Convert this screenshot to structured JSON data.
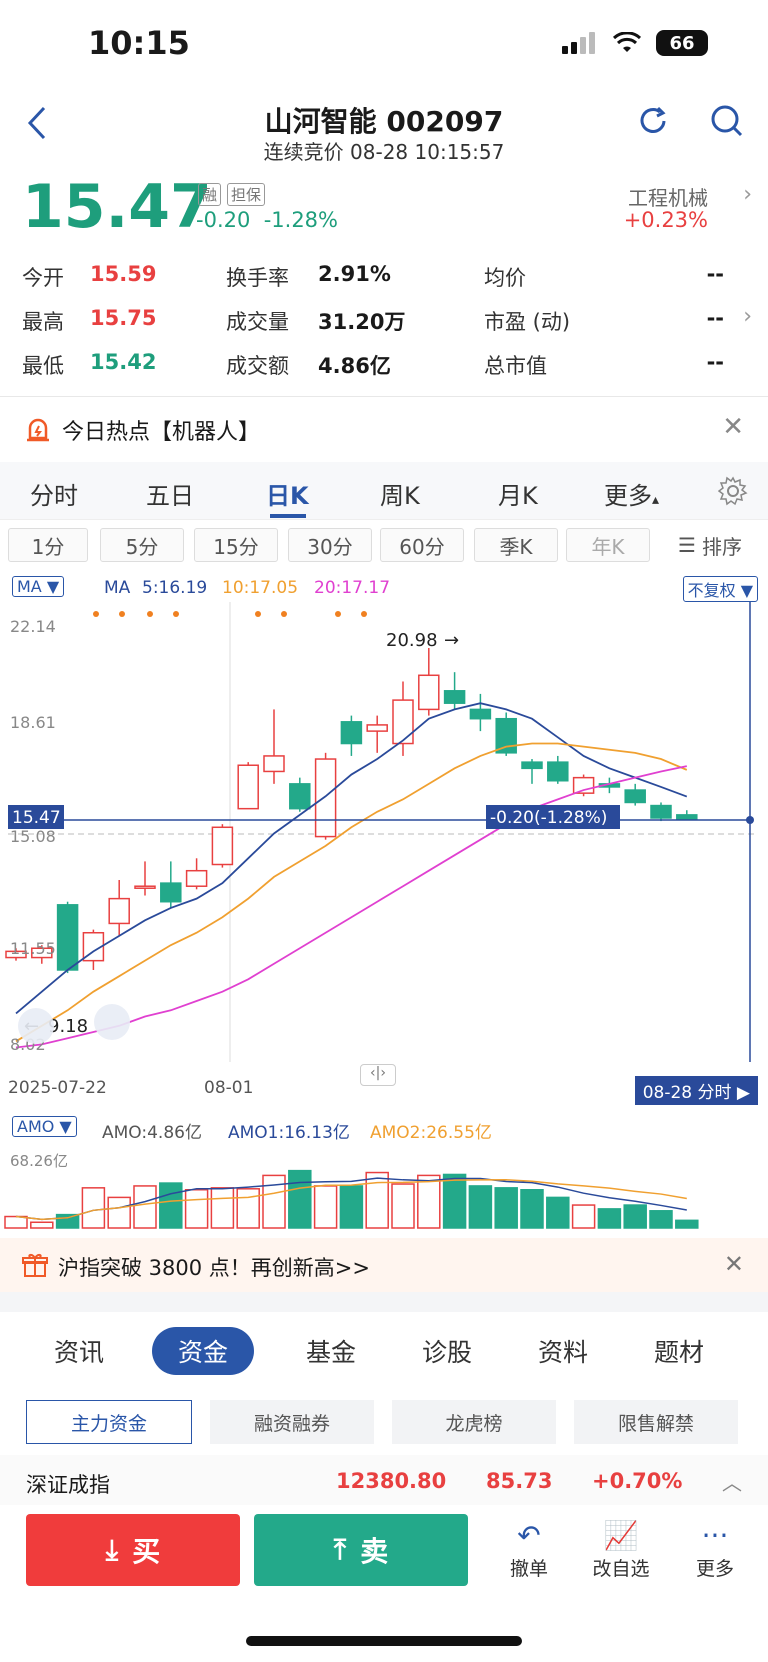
{
  "status": {
    "time": "10:15",
    "battery": "66"
  },
  "header": {
    "title": "山河智能 002097",
    "subtitle": "连续竞价 08-28 10:15:57"
  },
  "quote": {
    "price": "15.47",
    "tag1": "融",
    "tag2": "担保",
    "change": "-0.20",
    "change_pct": "-1.28%",
    "sector": "工程机械",
    "sector_change": "+0.23%"
  },
  "stats": {
    "open_label": "今开",
    "open": "15.59",
    "high_label": "最高",
    "high": "15.75",
    "low_label": "最低",
    "low": "15.42",
    "turnover_label": "换手率",
    "turnover": "2.91%",
    "volume_label": "成交量",
    "volume": "31.20万",
    "amount_label": "成交额",
    "amount": "4.86亿",
    "avg_label": "均价",
    "avg": "--",
    "pe_label": "市盈 (动)",
    "pe": "--",
    "mcap_label": "总市值",
    "mcap": "--"
  },
  "hot_topic": "今日热点【机器人】",
  "chart_tabs": [
    "分时",
    "五日",
    "日K",
    "周K",
    "月K",
    "更多"
  ],
  "period_buttons": [
    "1分",
    "5分",
    "15分",
    "30分",
    "60分",
    "季K",
    "年K",
    "排序"
  ],
  "ma_bar": {
    "chip": "MA",
    "ma_label": "MA",
    "ma5": "5:16.19",
    "ma10": "10:17.05",
    "ma20": "20:17.17",
    "adjust": "不复权"
  },
  "kline": {
    "y_labels": [
      "22.14",
      "18.61",
      "15.08",
      "11.55",
      "8.02"
    ],
    "price_tag": "15.47",
    "change_tag": "-0.20(-1.28%)",
    "high_mark": "20.98",
    "low_mark": "9.18",
    "date_start": "2025-07-22",
    "date_mid": "08-01",
    "intraday_btn": "08-28 分时",
    "colors": {
      "up": "#e84040",
      "down": "#23a98a",
      "ma5": "#2a4a9a",
      "ma10": "#f0a030",
      "ma20": "#e040d0"
    }
  },
  "chart_data": {
    "type": "candlestick",
    "ylim": [
      8.02,
      22.14
    ],
    "candles": [
      {
        "o": 11.0,
        "c": 11.2,
        "h": 11.3,
        "l": 10.9
      },
      {
        "o": 11.0,
        "c": 11.3,
        "h": 11.4,
        "l": 10.8
      },
      {
        "o": 12.7,
        "c": 10.6,
        "h": 12.8,
        "l": 10.5
      },
      {
        "o": 10.9,
        "c": 11.8,
        "h": 11.9,
        "l": 10.6
      },
      {
        "o": 12.1,
        "c": 12.9,
        "h": 13.5,
        "l": 11.7
      },
      {
        "o": 13.3,
        "c": 13.3,
        "h": 14.1,
        "l": 13.0
      },
      {
        "o": 13.4,
        "c": 12.8,
        "h": 14.1,
        "l": 12.6
      },
      {
        "o": 13.3,
        "c": 13.8,
        "h": 14.2,
        "l": 13.2
      },
      {
        "o": 14.0,
        "c": 15.2,
        "h": 15.3,
        "l": 13.9
      },
      {
        "o": 15.8,
        "c": 17.2,
        "h": 17.3,
        "l": 15.8
      },
      {
        "o": 17.0,
        "c": 17.5,
        "h": 19.0,
        "l": 16.6
      },
      {
        "o": 16.6,
        "c": 15.8,
        "h": 16.8,
        "l": 15.7
      },
      {
        "o": 14.9,
        "c": 17.4,
        "h": 17.6,
        "l": 14.8
      },
      {
        "o": 18.6,
        "c": 17.9,
        "h": 18.8,
        "l": 17.5
      },
      {
        "o": 18.3,
        "c": 18.5,
        "h": 18.8,
        "l": 17.6
      },
      {
        "o": 17.9,
        "c": 19.3,
        "h": 19.9,
        "l": 17.5
      },
      {
        "o": 19.0,
        "c": 20.1,
        "h": 20.98,
        "l": 18.8
      },
      {
        "o": 19.6,
        "c": 19.2,
        "h": 20.2,
        "l": 19.0
      },
      {
        "o": 19.0,
        "c": 18.7,
        "h": 19.5,
        "l": 18.3
      },
      {
        "o": 18.7,
        "c": 17.6,
        "h": 18.9,
        "l": 17.5
      },
      {
        "o": 17.3,
        "c": 17.1,
        "h": 17.4,
        "l": 16.6
      },
      {
        "o": 17.3,
        "c": 16.7,
        "h": 17.5,
        "l": 16.6
      },
      {
        "o": 16.3,
        "c": 16.8,
        "h": 16.9,
        "l": 16.2
      },
      {
        "o": 16.6,
        "c": 16.5,
        "h": 16.8,
        "l": 16.3
      },
      {
        "o": 16.4,
        "c": 16.0,
        "h": 16.6,
        "l": 15.9
      },
      {
        "o": 15.9,
        "c": 15.5,
        "h": 16.0,
        "l": 15.4
      },
      {
        "o": 15.6,
        "c": 15.47,
        "h": 15.75,
        "l": 15.42
      }
    ],
    "ma5": [
      9.2,
      9.9,
      10.6,
      11.2,
      11.7,
      12.2,
      12.6,
      12.9,
      13.4,
      14.2,
      15.0,
      15.6,
      16.2,
      16.9,
      17.4,
      18.0,
      18.7,
      19.0,
      19.2,
      19.0,
      18.7,
      18.1,
      17.5,
      17.1,
      16.8,
      16.5,
      16.19
    ],
    "ma10": [
      8.3,
      8.8,
      9.3,
      9.9,
      10.4,
      10.9,
      11.4,
      11.8,
      12.3,
      12.9,
      13.6,
      14.1,
      14.6,
      15.2,
      15.7,
      16.1,
      16.6,
      17.1,
      17.5,
      17.8,
      17.9,
      17.9,
      17.8,
      17.7,
      17.6,
      17.4,
      17.05
    ],
    "ma20": [
      8.1,
      8.2,
      8.4,
      8.6,
      8.8,
      9.1,
      9.3,
      9.6,
      9.9,
      10.3,
      10.8,
      11.3,
      11.8,
      12.3,
      12.8,
      13.3,
      13.8,
      14.3,
      14.8,
      15.3,
      15.8,
      16.1,
      16.4,
      16.6,
      16.8,
      17.0,
      17.17
    ],
    "volume": {
      "max_label": "68.26亿",
      "values": [
        0.12,
        0.06,
        0.14,
        0.42,
        0.32,
        0.44,
        0.47,
        0.4,
        0.42,
        0.41,
        0.55,
        0.6,
        0.44,
        0.44,
        0.58,
        0.46,
        0.55,
        0.56,
        0.44,
        0.42,
        0.4,
        0.32,
        0.24,
        0.2,
        0.24,
        0.18,
        0.08
      ]
    }
  },
  "amo_bar": {
    "chip": "AMO",
    "amo": "AMO:4.86亿",
    "amo1": "AMO1:16.13亿",
    "amo2": "AMO2:26.55亿"
  },
  "news_banner": "沪指突破 3800 点！再创新高>>",
  "bottom_tabs": [
    "资讯",
    "资金",
    "基金",
    "诊股",
    "资料",
    "题材"
  ],
  "sub_tabs": [
    "主力资金",
    "融资融券",
    "龙虎榜",
    "限售解禁"
  ],
  "index_row": {
    "name": "深证成指",
    "value": "12380.80",
    "change": "85.73",
    "pct": "+0.70%"
  },
  "actions": {
    "buy": "买",
    "sell": "卖",
    "cancel": "撤单",
    "watch": "改自选",
    "more": "更多"
  }
}
